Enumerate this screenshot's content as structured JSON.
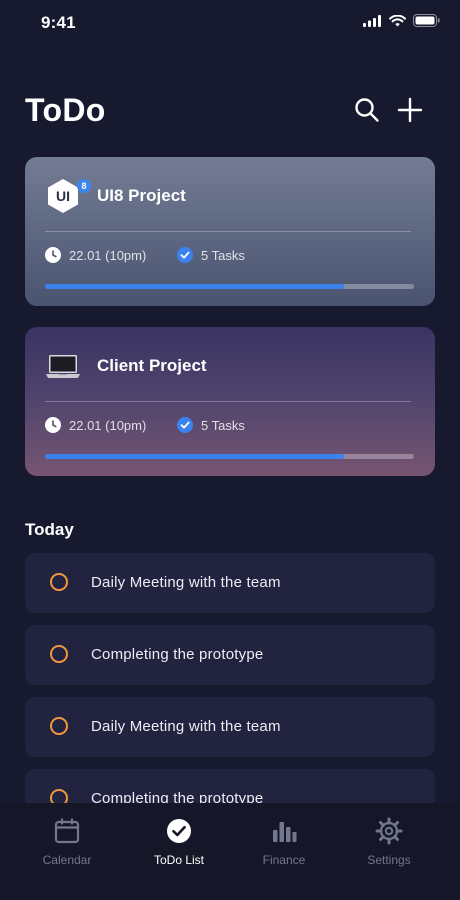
{
  "status_bar": {
    "time": "9:41"
  },
  "header": {
    "title": "ToDo"
  },
  "projects": [
    {
      "logo_text": "UI",
      "badge": "8",
      "name": "UI8 Project",
      "date": "22.01 (10pm)",
      "tasks": "5 Tasks",
      "progress": 0.81
    },
    {
      "name": "Client Project",
      "date": "22.01 (10pm)",
      "tasks": "5 Tasks",
      "progress": 0.81
    }
  ],
  "today": {
    "title": "Today",
    "tasks": [
      {
        "label": "Daily Meeting with the team"
      },
      {
        "label": "Completing the prototype"
      },
      {
        "label": "Daily Meeting with the team"
      },
      {
        "label": "Completing the prototype"
      }
    ]
  },
  "tabs": [
    {
      "label": "Calendar",
      "icon": "calendar-icon"
    },
    {
      "label": "ToDo List",
      "icon": "check-circle-icon",
      "active": true
    },
    {
      "label": "Finance",
      "icon": "bar-chart-icon"
    },
    {
      "label": "Settings",
      "icon": "gear-icon"
    }
  ],
  "colors": {
    "accent": "#3a82ee",
    "task_circle": "#f2963e",
    "background": "#171a2f"
  }
}
